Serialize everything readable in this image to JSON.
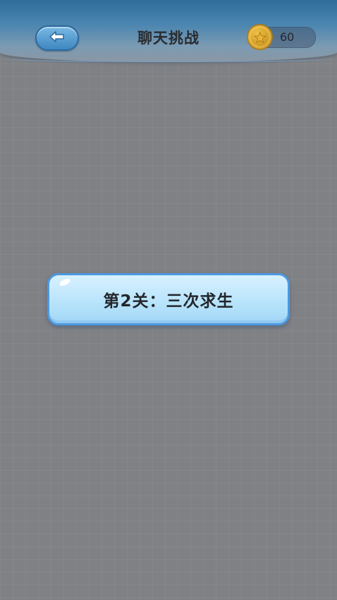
{
  "header": {
    "title": "聊天挑战",
    "back_icon": "back-arrow-icon",
    "coins": {
      "icon": "coin-icon",
      "count": "60"
    }
  },
  "level_banner": {
    "text": "第2关：三次求生"
  },
  "colors": {
    "header_blue": "#3f87c1",
    "overlay": "#7f8184",
    "banner_fill": "#b9e4fb",
    "banner_border": "#4c99e0",
    "coin_gold": "#f0c24a"
  }
}
